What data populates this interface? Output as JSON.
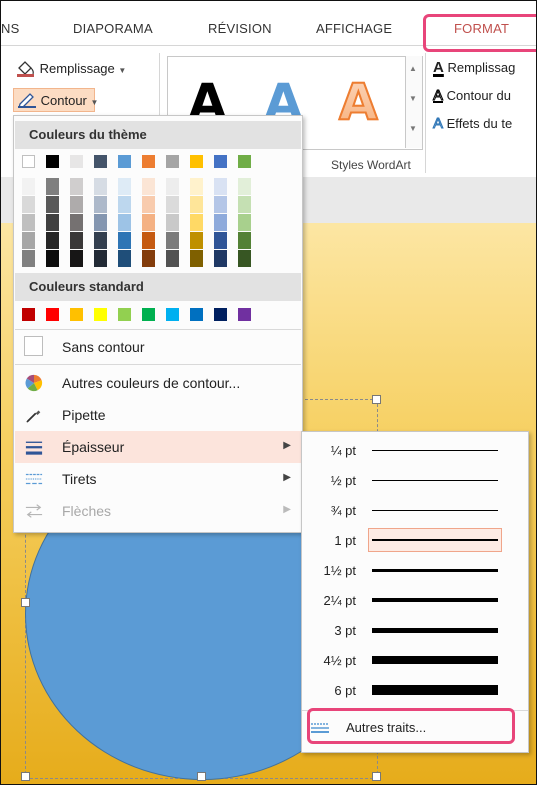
{
  "ribbon_tabs": {
    "t1": "NS",
    "t2": "DIAPORAMA",
    "t3": "RÉVISION",
    "t4": "AFFICHAGE",
    "t5": "FORMAT"
  },
  "ribbon": {
    "remplissage": "Remplissage",
    "contour": "Contour",
    "wordart_letter": "A",
    "group_label": "Styles WordArt",
    "right_remplissage": "Remplissag",
    "right_contour": "Contour du",
    "right_effets": "Effets du te"
  },
  "menu": {
    "theme_header": "Couleurs du thème",
    "standard_header": "Couleurs standard",
    "theme_top_row": [
      "#ffffff",
      "#000000",
      "#e7e6e6",
      "#44546a",
      "#5b9bd5",
      "#ed7d31",
      "#a5a5a5",
      "#ffc000",
      "#4472c4",
      "#70ad47"
    ],
    "theme_columns": [
      [
        "#f2f2f2",
        "#d9d9d9",
        "#bfbfbf",
        "#a6a6a6",
        "#808080"
      ],
      [
        "#7f7f7f",
        "#595959",
        "#404040",
        "#262626",
        "#0d0d0d"
      ],
      [
        "#d0cece",
        "#aeabab",
        "#757171",
        "#3a3838",
        "#171616"
      ],
      [
        "#d6dce4",
        "#adb9ca",
        "#8496b0",
        "#333f4f",
        "#222a35"
      ],
      [
        "#deebf6",
        "#bdd7ee",
        "#9dc3e6",
        "#2e75b5",
        "#1f4e79"
      ],
      [
        "#fbe5d5",
        "#f8cbad",
        "#f4b183",
        "#c55a11",
        "#833c0b"
      ],
      [
        "#ededed",
        "#dbdbdb",
        "#c9c9c9",
        "#7b7b7b",
        "#525252"
      ],
      [
        "#fff2cc",
        "#fee599",
        "#ffd965",
        "#bf9000",
        "#7f6000"
      ],
      [
        "#d9e2f3",
        "#b4c6e7",
        "#8eaadb",
        "#2f5496",
        "#1f3864"
      ],
      [
        "#e2efd9",
        "#c5e0b3",
        "#a8d08d",
        "#538135",
        "#375623"
      ]
    ],
    "standard_colors": [
      "#c00000",
      "#ff0000",
      "#ffc000",
      "#ffff00",
      "#92d050",
      "#00b050",
      "#00b0f0",
      "#0070c0",
      "#002060",
      "#7030a0"
    ],
    "items": {
      "sans_contour": "Sans contour",
      "autres_couleurs": "Autres couleurs de contour...",
      "pipette": "Pipette",
      "epaisseur": "Épaisseur",
      "tirets": "Tirets",
      "fleches": "Flèches"
    }
  },
  "submenu": {
    "weights": [
      {
        "label": "¼ pt",
        "w": 0.25
      },
      {
        "label": "½ pt",
        "w": 0.5
      },
      {
        "label": "¾ pt",
        "w": 0.75
      },
      {
        "label": "1 pt",
        "w": 1
      },
      {
        "label": "1½ pt",
        "w": 1.5
      },
      {
        "label": "2¼ pt",
        "w": 2.25
      },
      {
        "label": "3 pt",
        "w": 3
      },
      {
        "label": "4½ pt",
        "w": 4.5
      },
      {
        "label": "6 pt",
        "w": 6
      }
    ],
    "selected_label": "1 pt",
    "autres_traits": "Autres traits..."
  },
  "colors": {
    "accent_callout": "#e8457a",
    "format_tab": "#c0504d",
    "highlight": "#fce4dc"
  }
}
